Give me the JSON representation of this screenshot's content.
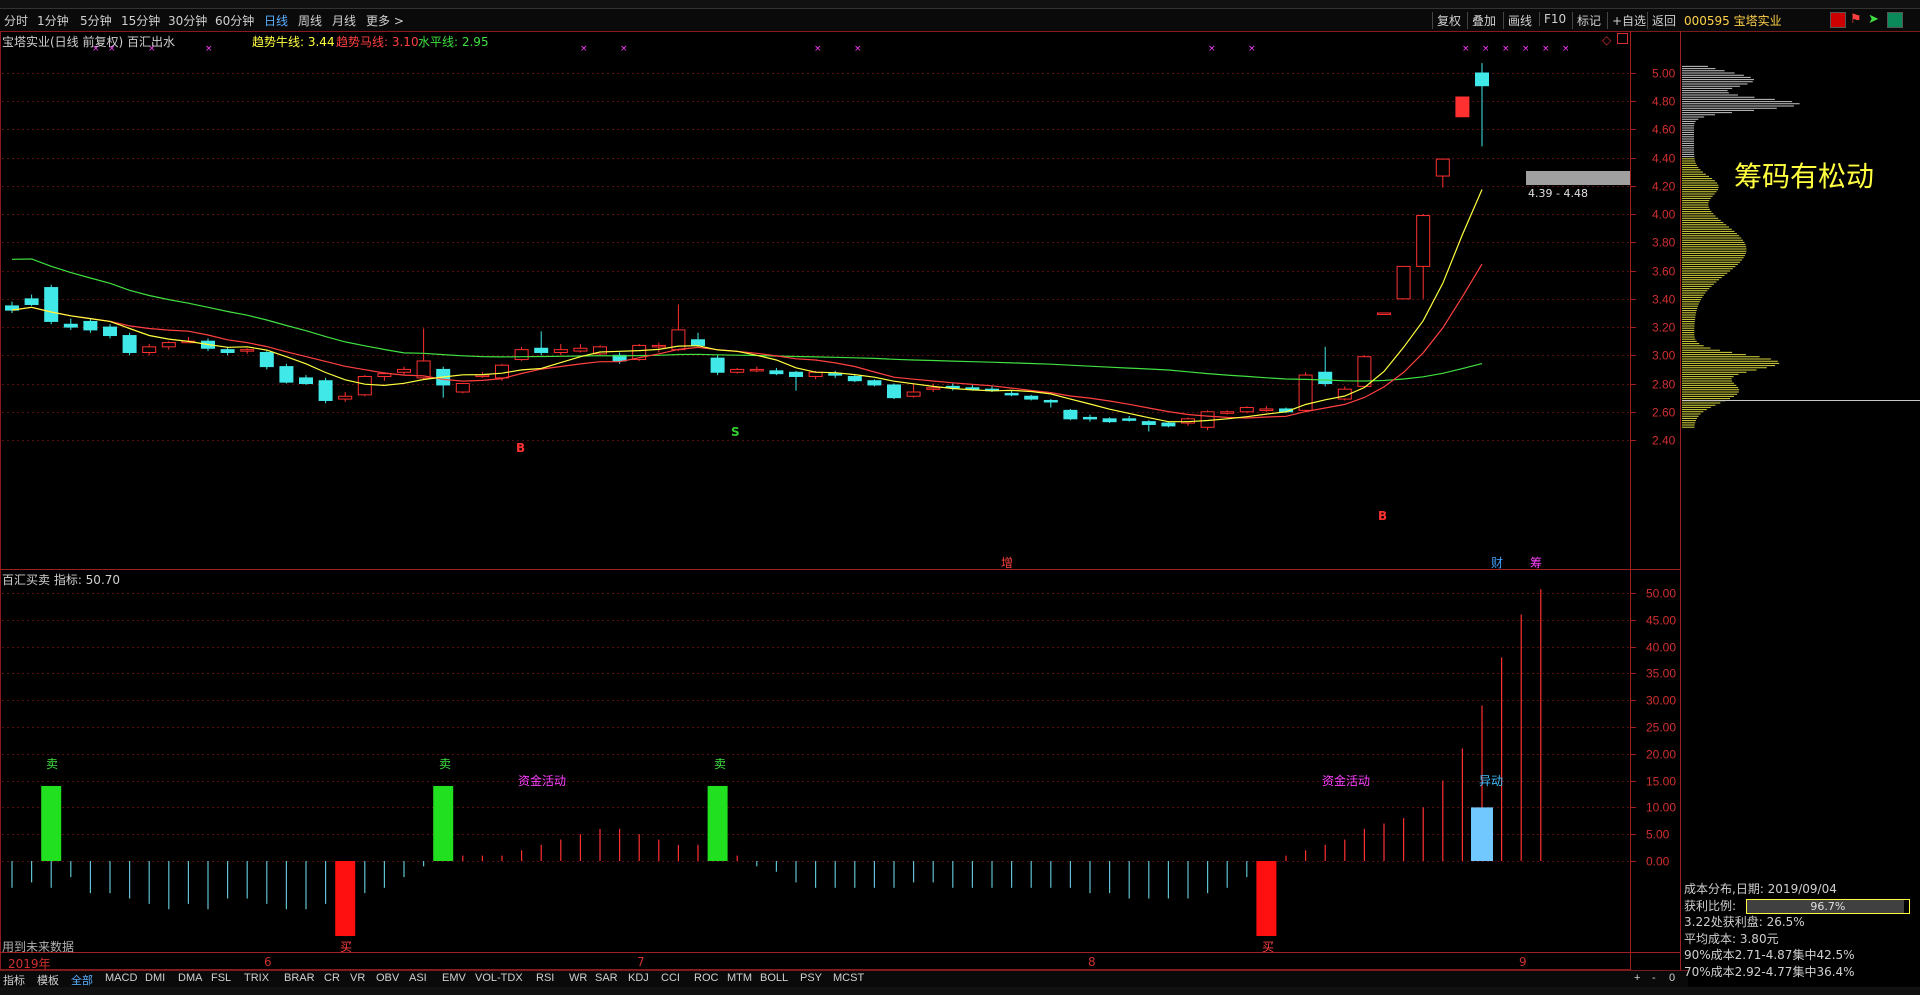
{
  "toolbar": {
    "periods": [
      "分时",
      "1分钟",
      "5分钟",
      "15分钟",
      "30分钟",
      "60分钟",
      "日线",
      "周线",
      "月线",
      "更多 >"
    ],
    "active_period": "日线",
    "right_buttons": [
      "复权",
      "叠加",
      "画线",
      "F10",
      "标记",
      "+自选",
      "返回"
    ],
    "stock_code_name": "000595 宝塔实业"
  },
  "main_chart": {
    "title": "宝塔实业(日线 前复权) 百汇出水",
    "legend": [
      {
        "label": "趋势牛线: 3.44",
        "color": "#ffff40"
      },
      {
        "label": "趋势马线: 3.10",
        "color": "#ff4040"
      },
      {
        "label": "水平线: 2.95",
        "color": "#40e040"
      }
    ],
    "price_ticks": [
      "5.00",
      "4.80",
      "4.60",
      "4.40",
      "4.20",
      "4.00",
      "3.80",
      "3.60",
      "3.40",
      "3.20",
      "3.00",
      "2.80",
      "2.60",
      "2.40"
    ],
    "range_label": "4.39 - 4.48",
    "overlay_text": "筹码有松动",
    "markers": {
      "b1": "B",
      "s1": "S",
      "b2": "B",
      "zeng": "增",
      "cai": "财",
      "chou": "筹"
    }
  },
  "indicator_chart": {
    "title": "百汇买卖 指标: 50.70",
    "ticks": [
      "50.00",
      "45.00",
      "40.00",
      "35.00",
      "30.00",
      "25.00",
      "20.00",
      "15.00",
      "10.00",
      "5.00",
      "0.00"
    ],
    "labels": {
      "sell": "卖",
      "buy": "买",
      "fund": "资金活动",
      "abnormal": "异动"
    },
    "footer_note": "用到未来数据"
  },
  "x_axis": {
    "labels": [
      "2019年",
      "6",
      "7",
      "8",
      "9"
    ]
  },
  "bottom_tabs": {
    "items": [
      "指标",
      "模板",
      "全部",
      "MACD",
      "DMI",
      "DMA",
      "FSL",
      "TRIX",
      "BRAR",
      "CR",
      "VR",
      "OBV",
      "ASI",
      "EMV",
      "VOL-TDX",
      "RSI",
      "WR",
      "SAR",
      "KDJ",
      "CCI",
      "ROC",
      "MTM",
      "BOLL",
      "PSY",
      "MCST"
    ],
    "active": "全部",
    "controls": [
      "+",
      "-",
      "0"
    ]
  },
  "chip_info": {
    "rows": [
      "成本分布,日期: 2019/09/04",
      "获利比例:",
      "3.22处获利盘: 26.5%",
      "平均成本: 3.80元",
      "90%成本2.71-4.87集中42.5%",
      "70%成本2.92-4.77集中36.4%"
    ],
    "profit_ratio": "96.7%"
  },
  "chart_data": {
    "type": "candlestick",
    "title": "宝塔实业(日线 前复权)",
    "ylim": [
      2.35,
      5.15
    ],
    "candles": [
      {
        "o": 3.35,
        "h": 3.38,
        "l": 3.3,
        "c": 3.32
      },
      {
        "o": 3.4,
        "h": 3.43,
        "l": 3.35,
        "c": 3.36
      },
      {
        "o": 3.48,
        "h": 3.5,
        "l": 3.22,
        "c": 3.24
      },
      {
        "o": 3.22,
        "h": 3.26,
        "l": 3.18,
        "c": 3.2
      },
      {
        "o": 3.24,
        "h": 3.26,
        "l": 3.16,
        "c": 3.18
      },
      {
        "o": 3.2,
        "h": 3.22,
        "l": 3.12,
        "c": 3.14
      },
      {
        "o": 3.14,
        "h": 3.16,
        "l": 3.0,
        "c": 3.02
      },
      {
        "o": 3.02,
        "h": 3.08,
        "l": 3.0,
        "c": 3.06
      },
      {
        "o": 3.06,
        "h": 3.1,
        "l": 3.04,
        "c": 3.09
      },
      {
        "o": 3.1,
        "h": 3.13,
        "l": 3.09,
        "c": 3.1
      },
      {
        "o": 3.1,
        "h": 3.12,
        "l": 3.03,
        "c": 3.05
      },
      {
        "o": 3.04,
        "h": 3.06,
        "l": 3.0,
        "c": 3.02
      },
      {
        "o": 3.03,
        "h": 3.05,
        "l": 3.01,
        "c": 3.04
      },
      {
        "o": 3.02,
        "h": 3.03,
        "l": 2.9,
        "c": 2.92
      },
      {
        "o": 2.92,
        "h": 2.94,
        "l": 2.8,
        "c": 2.81
      },
      {
        "o": 2.84,
        "h": 2.86,
        "l": 2.79,
        "c": 2.8
      },
      {
        "o": 2.82,
        "h": 2.84,
        "l": 2.66,
        "c": 2.68
      },
      {
        "o": 2.69,
        "h": 2.74,
        "l": 2.67,
        "c": 2.71
      },
      {
        "o": 2.72,
        "h": 2.86,
        "l": 2.71,
        "c": 2.85
      },
      {
        "o": 2.85,
        "h": 2.88,
        "l": 2.82,
        "c": 2.87
      },
      {
        "o": 2.88,
        "h": 2.92,
        "l": 2.86,
        "c": 2.9
      },
      {
        "o": 2.84,
        "h": 3.19,
        "l": 2.83,
        "c": 2.96
      },
      {
        "o": 2.9,
        "h": 2.92,
        "l": 2.7,
        "c": 2.79
      },
      {
        "o": 2.74,
        "h": 2.8,
        "l": 2.73,
        "c": 2.8
      },
      {
        "o": 2.85,
        "h": 2.88,
        "l": 2.84,
        "c": 2.86
      },
      {
        "o": 2.84,
        "h": 2.94,
        "l": 2.82,
        "c": 2.93
      },
      {
        "o": 2.97,
        "h": 3.06,
        "l": 2.96,
        "c": 3.04
      },
      {
        "o": 3.05,
        "h": 3.17,
        "l": 3.0,
        "c": 3.02
      },
      {
        "o": 3.02,
        "h": 3.08,
        "l": 3.0,
        "c": 3.04
      },
      {
        "o": 3.03,
        "h": 3.08,
        "l": 3.02,
        "c": 3.05
      },
      {
        "o": 3.01,
        "h": 3.07,
        "l": 3.0,
        "c": 3.06
      },
      {
        "o": 3.0,
        "h": 3.02,
        "l": 2.94,
        "c": 2.96
      },
      {
        "o": 2.97,
        "h": 3.08,
        "l": 2.96,
        "c": 3.07
      },
      {
        "o": 3.06,
        "h": 3.09,
        "l": 3.02,
        "c": 3.07
      },
      {
        "o": 3.04,
        "h": 3.36,
        "l": 3.03,
        "c": 3.18
      },
      {
        "o": 3.11,
        "h": 3.16,
        "l": 3.06,
        "c": 3.07
      },
      {
        "o": 2.98,
        "h": 3.0,
        "l": 2.86,
        "c": 2.88
      },
      {
        "o": 2.88,
        "h": 2.91,
        "l": 2.87,
        "c": 2.9
      },
      {
        "o": 2.89,
        "h": 2.92,
        "l": 2.88,
        "c": 2.9
      },
      {
        "o": 2.89,
        "h": 2.91,
        "l": 2.86,
        "c": 2.87
      },
      {
        "o": 2.88,
        "h": 2.89,
        "l": 2.75,
        "c": 2.85
      },
      {
        "o": 2.85,
        "h": 2.89,
        "l": 2.83,
        "c": 2.88
      },
      {
        "o": 2.87,
        "h": 2.89,
        "l": 2.84,
        "c": 2.86
      },
      {
        "o": 2.85,
        "h": 2.86,
        "l": 2.81,
        "c": 2.82
      },
      {
        "o": 2.82,
        "h": 2.83,
        "l": 2.78,
        "c": 2.79
      },
      {
        "o": 2.79,
        "h": 2.8,
        "l": 2.69,
        "c": 2.7
      },
      {
        "o": 2.71,
        "h": 2.8,
        "l": 2.7,
        "c": 2.74
      },
      {
        "o": 2.76,
        "h": 2.8,
        "l": 2.74,
        "c": 2.77
      },
      {
        "o": 2.78,
        "h": 2.8,
        "l": 2.75,
        "c": 2.77
      },
      {
        "o": 2.77,
        "h": 2.79,
        "l": 2.75,
        "c": 2.76
      },
      {
        "o": 2.76,
        "h": 2.78,
        "l": 2.74,
        "c": 2.75
      },
      {
        "o": 2.73,
        "h": 2.75,
        "l": 2.71,
        "c": 2.72
      },
      {
        "o": 2.71,
        "h": 2.72,
        "l": 2.68,
        "c": 2.69
      },
      {
        "o": 2.68,
        "h": 2.69,
        "l": 2.63,
        "c": 2.67
      },
      {
        "o": 2.61,
        "h": 2.62,
        "l": 2.54,
        "c": 2.55
      },
      {
        "o": 2.56,
        "h": 2.58,
        "l": 2.53,
        "c": 2.55
      },
      {
        "o": 2.55,
        "h": 2.56,
        "l": 2.52,
        "c": 2.53
      },
      {
        "o": 2.55,
        "h": 2.57,
        "l": 2.53,
        "c": 2.54
      },
      {
        "o": 2.53,
        "h": 2.54,
        "l": 2.46,
        "c": 2.51
      },
      {
        "o": 2.52,
        "h": 2.53,
        "l": 2.49,
        "c": 2.5
      },
      {
        "o": 2.52,
        "h": 2.56,
        "l": 2.5,
        "c": 2.55
      },
      {
        "o": 2.49,
        "h": 2.61,
        "l": 2.47,
        "c": 2.6
      },
      {
        "o": 2.59,
        "h": 2.61,
        "l": 2.58,
        "c": 2.6
      },
      {
        "o": 2.6,
        "h": 2.64,
        "l": 2.59,
        "c": 2.63
      },
      {
        "o": 2.61,
        "h": 2.64,
        "l": 2.6,
        "c": 2.62
      },
      {
        "o": 2.62,
        "h": 2.63,
        "l": 2.59,
        "c": 2.6
      },
      {
        "o": 2.61,
        "h": 2.88,
        "l": 2.6,
        "c": 2.86
      },
      {
        "o": 2.88,
        "h": 3.06,
        "l": 2.78,
        "c": 2.8
      },
      {
        "o": 2.69,
        "h": 2.78,
        "l": 2.68,
        "c": 2.76
      },
      {
        "o": 2.78,
        "h": 3.0,
        "l": 2.77,
        "c": 2.99
      },
      {
        "o": 3.3,
        "h": 3.3,
        "l": 3.3,
        "c": 3.3
      },
      {
        "o": 3.4,
        "h": 3.63,
        "l": 3.4,
        "c": 3.63
      },
      {
        "o": 3.63,
        "h": 4.0,
        "l": 3.4,
        "c": 3.99
      },
      {
        "o": 4.27,
        "h": 4.39,
        "l": 4.19,
        "c": 4.39
      },
      {
        "o": 4.69,
        "h": 4.83,
        "l": 4.69,
        "c": 4.83
      },
      {
        "o": 5.0,
        "h": 5.07,
        "l": 4.48,
        "c": 4.91
      }
    ],
    "series": [
      {
        "name": "趋势牛线",
        "value": 3.44
      },
      {
        "name": "趋势马线",
        "value": 3.1
      },
      {
        "name": "水平线",
        "value": 2.95
      }
    ],
    "indicator": {
      "name": "百汇买卖",
      "value": 50.7,
      "ylim": [
        -15,
        52
      ],
      "values": [
        -5,
        -4,
        -5,
        -3,
        -6,
        -6,
        -7,
        -8,
        -9,
        -8,
        -9,
        -7,
        -7,
        -8,
        -9,
        -9,
        -8,
        -7,
        -6,
        -5,
        -3,
        -1,
        1,
        1,
        1,
        1,
        2,
        3,
        4,
        5,
        6,
        6,
        5,
        4,
        3,
        3,
        2,
        1,
        -1,
        -2,
        -4,
        -5,
        -5,
        -5,
        -5,
        -5,
        -4,
        -4,
        -5,
        -5,
        -5,
        -5,
        -5,
        -5,
        -5,
        -6,
        -6,
        -7,
        -7,
        -7,
        -7,
        -6,
        -5,
        -3,
        -2,
        1,
        2,
        3,
        4,
        6,
        7,
        8,
        10,
        15,
        21,
        29,
        38,
        46,
        50.7
      ],
      "sell_bars": [
        2,
        22,
        36
      ],
      "buy_bars": [
        17,
        64
      ],
      "abnormal_bar": 75
    }
  }
}
